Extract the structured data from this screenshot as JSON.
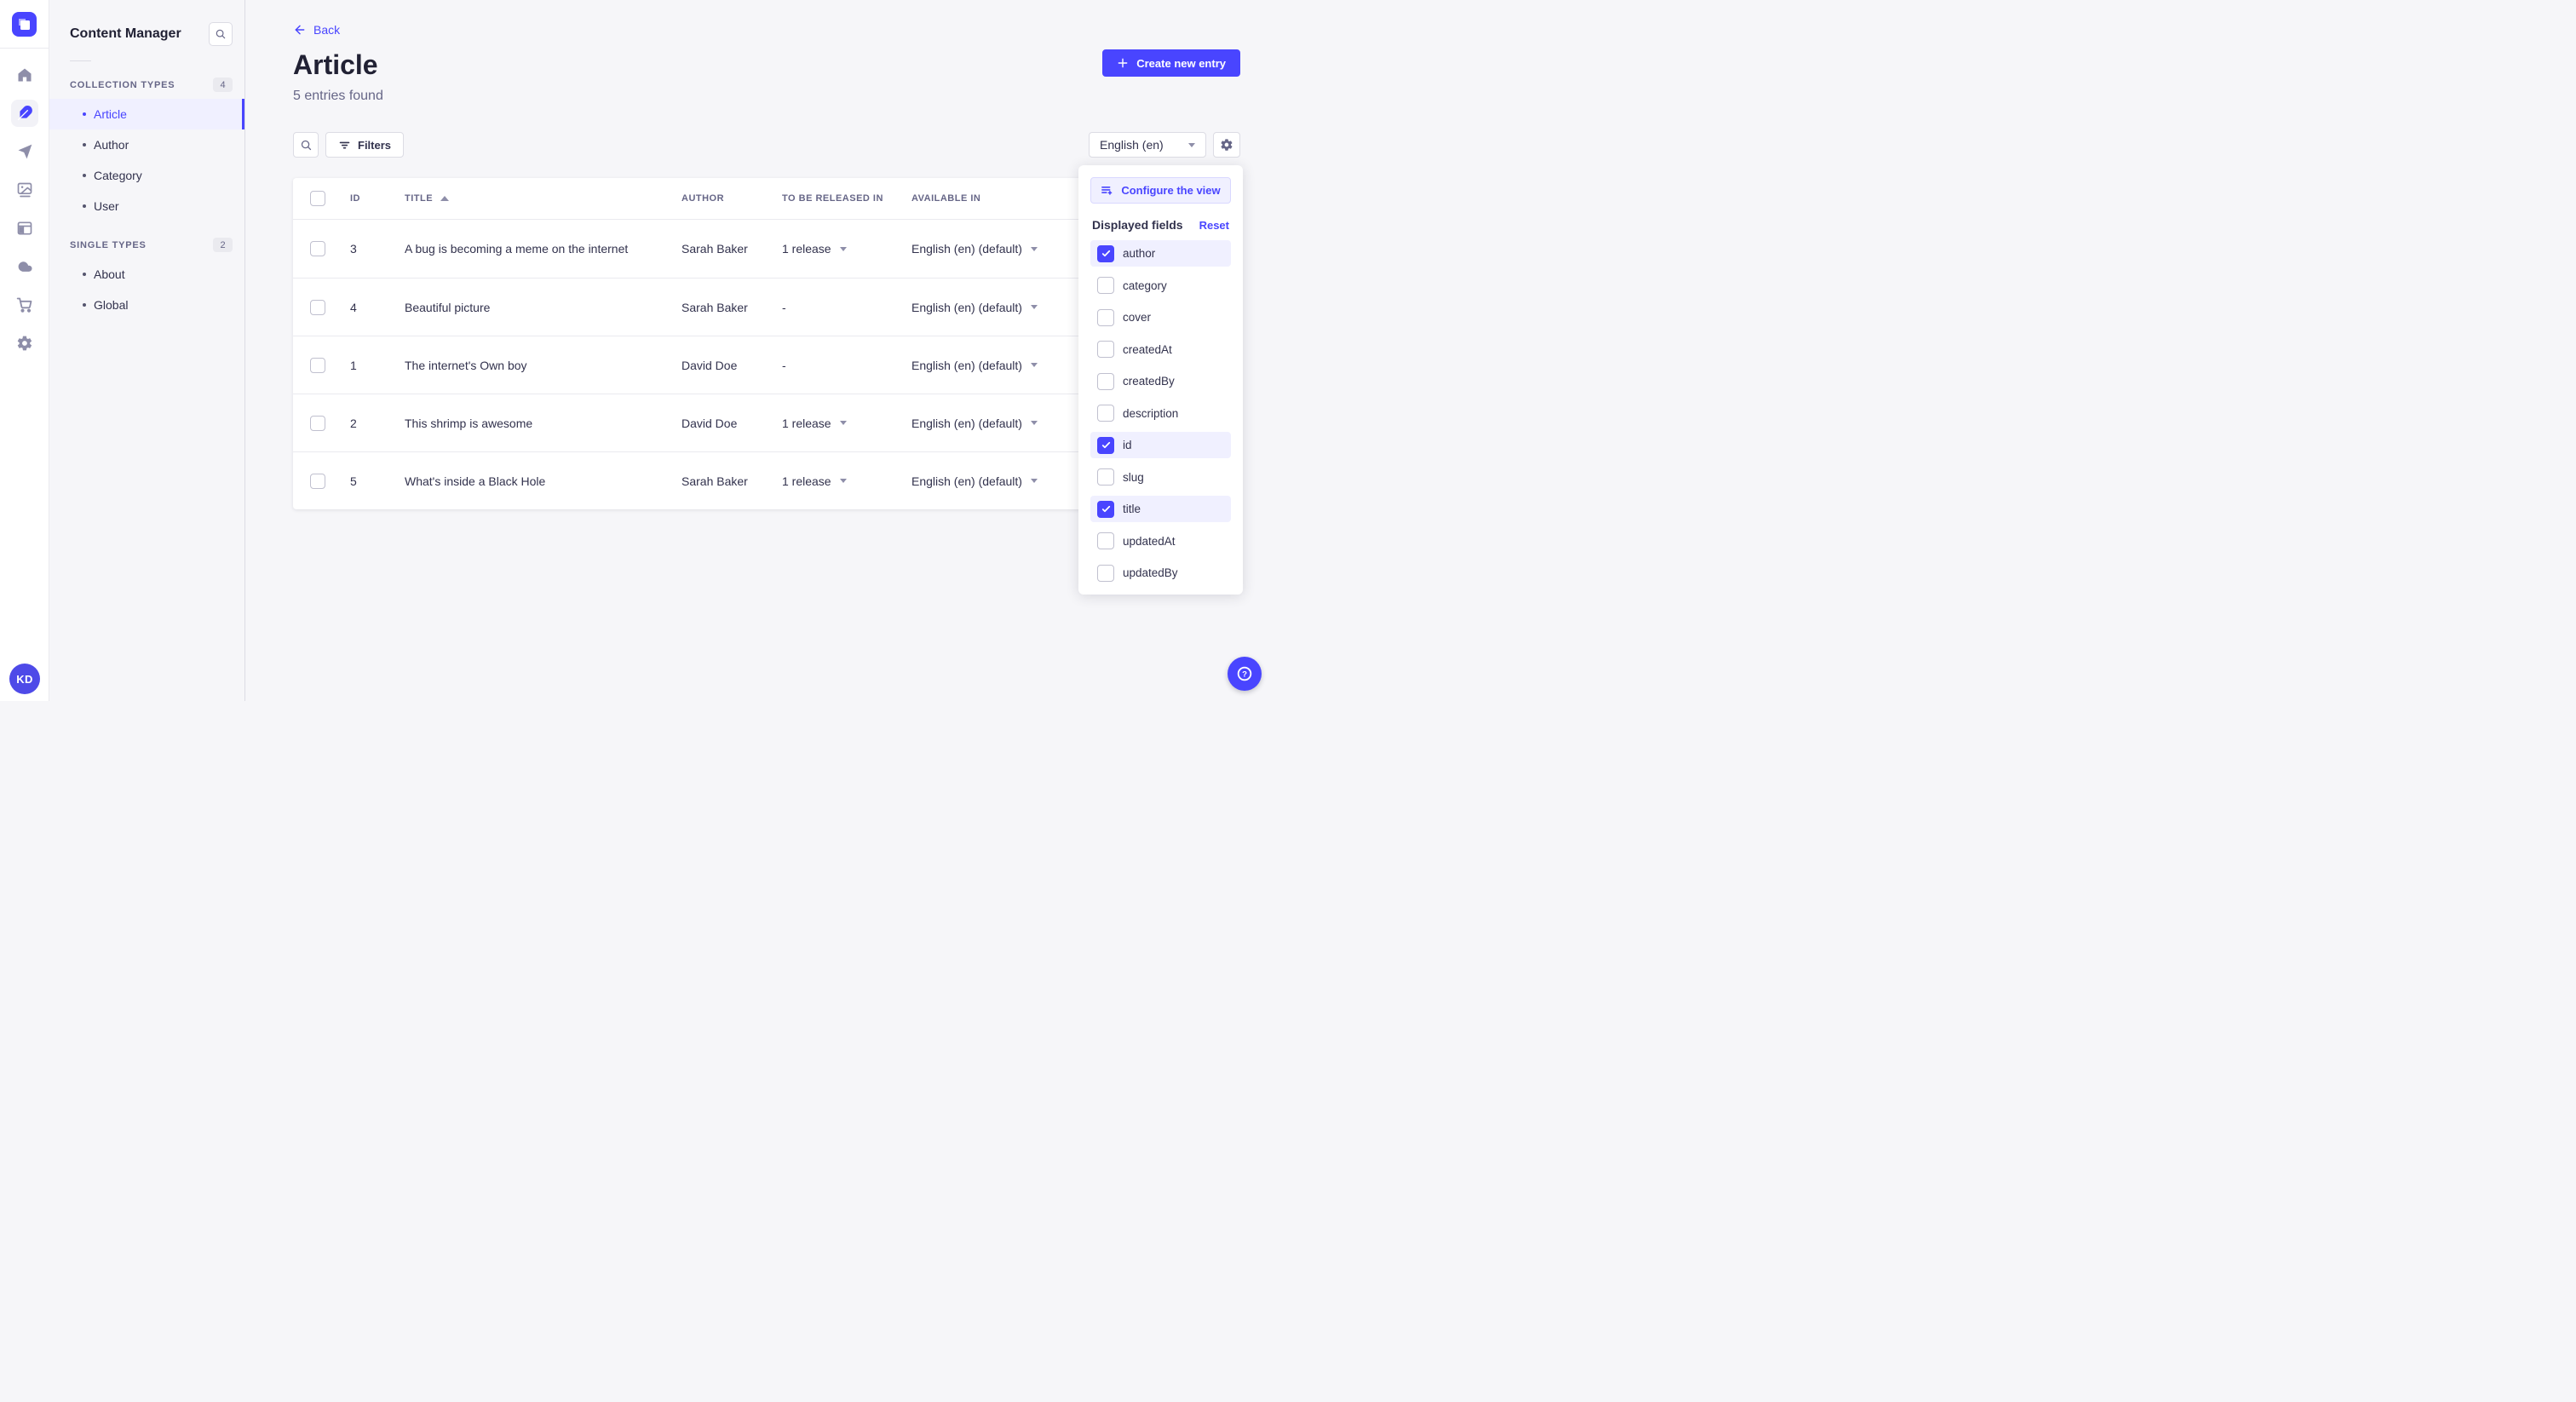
{
  "colors": {
    "accent": "#4945FF",
    "accent_light": "#F0F0FF",
    "text_dark": "#32324D",
    "text_muted": "#666687"
  },
  "rail": {
    "logo_icon": "strapi-logo",
    "icons": [
      "home-icon",
      "content-feather-icon",
      "send-icon",
      "media-images-icon",
      "layout-icon",
      "cloud-icon",
      "marketplace-cart-icon",
      "settings-gear-icon"
    ],
    "active_icon": "content-feather-icon",
    "avatar_initials": "KD"
  },
  "sidebar": {
    "title": "Content Manager",
    "sections": [
      {
        "label": "COLLECTION TYPES",
        "count": "4",
        "items": [
          {
            "label": "Article",
            "active": true
          },
          {
            "label": "Author",
            "active": false
          },
          {
            "label": "Category",
            "active": false
          },
          {
            "label": "User",
            "active": false
          }
        ]
      },
      {
        "label": "SINGLE TYPES",
        "count": "2",
        "items": [
          {
            "label": "About",
            "active": false
          },
          {
            "label": "Global",
            "active": false
          }
        ]
      }
    ]
  },
  "header": {
    "back_label": "Back",
    "title": "Article",
    "subtitle": "5 entries found",
    "create_button_label": "Create new entry"
  },
  "toolbar": {
    "filters_label": "Filters",
    "locale_value": "English (en)"
  },
  "table": {
    "columns": [
      "ID",
      "TITLE",
      "AUTHOR",
      "TO BE RELEASED IN",
      "AVAILABLE IN"
    ],
    "sorted_by": "TITLE",
    "sort_direction": "asc",
    "rows": [
      {
        "id": "3",
        "title": "A bug is becoming a meme on the internet",
        "author": "Sarah Baker",
        "releases": "1 release",
        "locale": "English (en) (default)"
      },
      {
        "id": "4",
        "title": "Beautiful picture",
        "author": "Sarah Baker",
        "releases": "-",
        "locale": "English (en) (default)"
      },
      {
        "id": "1",
        "title": "The internet's Own boy",
        "author": "David Doe",
        "releases": "-",
        "locale": "English (en) (default)"
      },
      {
        "id": "2",
        "title": "This shrimp is awesome",
        "author": "David Doe",
        "releases": "1 release",
        "locale": "English (en) (default)"
      },
      {
        "id": "5",
        "title": "What's inside a Black Hole",
        "author": "Sarah Baker",
        "releases": "1 release",
        "locale": "English (en) (default)"
      }
    ]
  },
  "popover": {
    "configure_label": "Configure the view",
    "fields_title": "Displayed fields",
    "reset_label": "Reset",
    "fields": [
      {
        "label": "author",
        "checked": true
      },
      {
        "label": "category",
        "checked": false
      },
      {
        "label": "cover",
        "checked": false
      },
      {
        "label": "createdAt",
        "checked": false
      },
      {
        "label": "createdBy",
        "checked": false
      },
      {
        "label": "description",
        "checked": false
      },
      {
        "label": "id",
        "checked": true
      },
      {
        "label": "slug",
        "checked": false
      },
      {
        "label": "title",
        "checked": true
      },
      {
        "label": "updatedAt",
        "checked": false
      },
      {
        "label": "updatedBy",
        "checked": false
      }
    ]
  },
  "help": {
    "icon": "question-icon"
  }
}
